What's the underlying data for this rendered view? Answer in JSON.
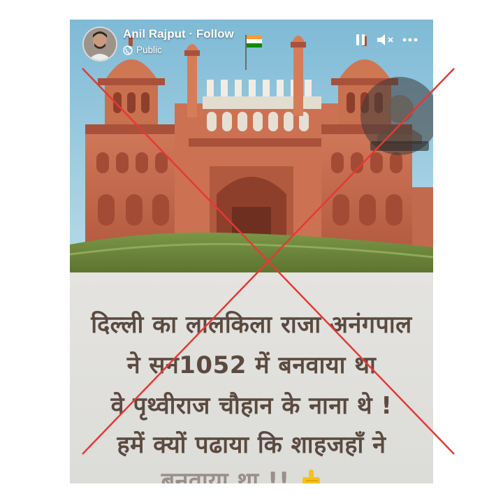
{
  "post": {
    "author": "Anil Rajput",
    "separator": "·",
    "follow_label": "Follow",
    "privacy": "Public"
  },
  "icons": {
    "privacy": "globe-icon",
    "pause": "pause-icon",
    "mute": "speaker-muted-icon",
    "more": "more-horizontal-icon",
    "pointing": "pointing-up-hand-icon"
  },
  "caption": {
    "line1": "दिल्ली का लालकिला राजा अनंगपाल",
    "line2": "ने सन1052 में बनवाया था",
    "line3": "वे पृथ्वीराज चौहान के नाना थे !",
    "line4": "हमें क्यों पढाया कि शाहजहाँ ने",
    "line5": "बनवाया था !!"
  },
  "colors": {
    "cross": "#e53935",
    "sky": "#8fc6df",
    "fort": "#c66a4f",
    "grass": "#6f8a3a",
    "caption_text": "#5b4a40"
  }
}
